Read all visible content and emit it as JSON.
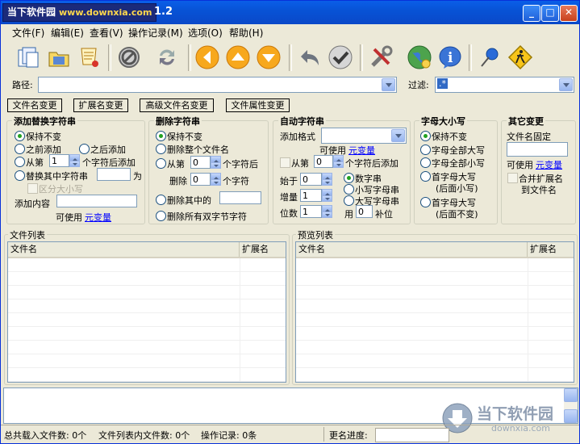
{
  "title": {
    "logo_text": "当下软件园",
    "logo_url": "www.downxia.com",
    "version": "1.2",
    "buttons": [
      "minimize",
      "maximize",
      "close"
    ]
  },
  "menu": [
    "文件(F)",
    "编辑(E)",
    "查看(V)",
    "操作记录(M)",
    "选项(O)",
    "帮助(H)"
  ],
  "toolbar": {
    "icons": [
      "add-files-icon",
      "open-folder-icon",
      "scroll-icon",
      "stop-icon",
      "refresh-icon",
      "arrow-left-icon",
      "arrow-up-icon",
      "arrow-down-icon",
      "undo-icon",
      "check-icon",
      "tools-icon",
      "globe-icon",
      "info-icon",
      "pin-icon",
      "warning-sign-icon"
    ]
  },
  "path": {
    "label": "路径:",
    "value": ""
  },
  "filter": {
    "label": "过滤:",
    "value": ".*"
  },
  "tabs": [
    "文件名变更",
    "扩展名变更",
    "高级文件名变更",
    "文件属性变更"
  ],
  "groups": {
    "replace": {
      "title": "添加替换字符串",
      "keep": "保持不变",
      "before": "之前添加",
      "after": "之后添加",
      "from": "从第",
      "from_val": "1",
      "from_suffix": "个字符后添加",
      "replace": "替换其中字符串",
      "as": "为",
      "case": "区分大小写",
      "content": "添加内容",
      "var_prefix": "可使用",
      "var_link": "元变量"
    },
    "delete": {
      "title": "删除字符串",
      "keep": "保持不变",
      "all": "删除整个文件名",
      "from": "从第",
      "from_val": "0",
      "from_suffix": "个字符后",
      "del": "删除",
      "del_val": "0",
      "del_suffix": "个字符",
      "within": "删除其中的",
      "double": "删除所有双字节字符"
    },
    "auto": {
      "title": "自动字符串",
      "format": "添加格式",
      "var_prefix": "可使用",
      "var_link": "元变量",
      "from": "从第",
      "from_val": "0",
      "from_suffix": "个字符后添加",
      "start": "始于",
      "start_val": "0",
      "step": "增量",
      "step_val": "1",
      "digits": "位数",
      "digits_val": "1",
      "num": "数字串",
      "lower": "小写字母串",
      "upper": "大写字母串",
      "pad_prefix": "用",
      "pad_val": "0",
      "pad_suffix": "补位"
    },
    "case": {
      "title": "字母大小写",
      "keep": "保持不变",
      "allupper": "字母全部大写",
      "alllower": "字母全部小写",
      "first_lower_1": "首字母大写",
      "first_lower_2": "(后面小写)",
      "first_keep_1": "首字母大写",
      "first_keep_2": "(后面不变)"
    },
    "other": {
      "title": "其它变更",
      "fixed": "文件名固定",
      "var_prefix": "可使用",
      "var_link": "元变量",
      "merge_1": "合并扩展名",
      "merge_2": "到文件名"
    }
  },
  "lists": {
    "files": {
      "title": "文件列表",
      "col1": "文件名",
      "col2": "扩展名"
    },
    "preview": {
      "title": "预览列表",
      "col1": "文件名",
      "col2": "扩展名"
    }
  },
  "status": {
    "total": "总共载入文件数: 0个",
    "inlist": "文件列表内文件数: 0个",
    "ops": "操作记录: 0条",
    "progress_label": "更名进度:"
  },
  "watermark": {
    "cn": "当下软件园",
    "url": "downxia.com"
  }
}
